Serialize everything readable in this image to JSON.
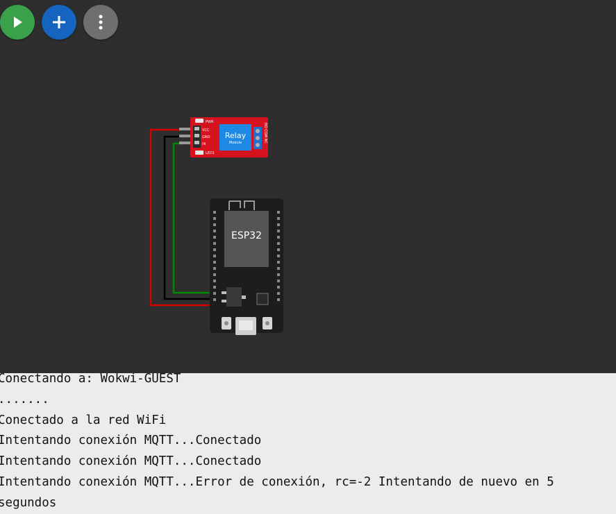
{
  "toolbar": {
    "play_icon": "play-icon",
    "add_icon": "plus-icon",
    "more_icon": "more-vertical-icon",
    "colors": {
      "play": "#3aa04a",
      "add": "#1565c0",
      "more": "#6f6f6f"
    }
  },
  "relay": {
    "title": "Relay",
    "subtitle": "Module",
    "pin_vcc": "VCC",
    "pin_gnd": "GND",
    "pin_in": "IN",
    "led_pwr": "PWR",
    "led_led1": "LED1",
    "terminals": "NO COM NC",
    "color": "#d5121d"
  },
  "esp32": {
    "label": "ESP32",
    "board_color": "#1d1d1d"
  },
  "wires": {
    "vcc": "#d60000",
    "gnd": "#000000",
    "signal": "#008a00"
  },
  "console": {
    "lines": [
      "Conectando a: Wokwi-GUEST",
      ".......",
      "Conectado a la red WiFi",
      "Intentando conexión MQTT...Conectado",
      "Intentando conexión MQTT...Conectado",
      "Intentando conexión MQTT...Error de conexión, rc=-2 Intentando de nuevo en 5 segundos"
    ]
  }
}
